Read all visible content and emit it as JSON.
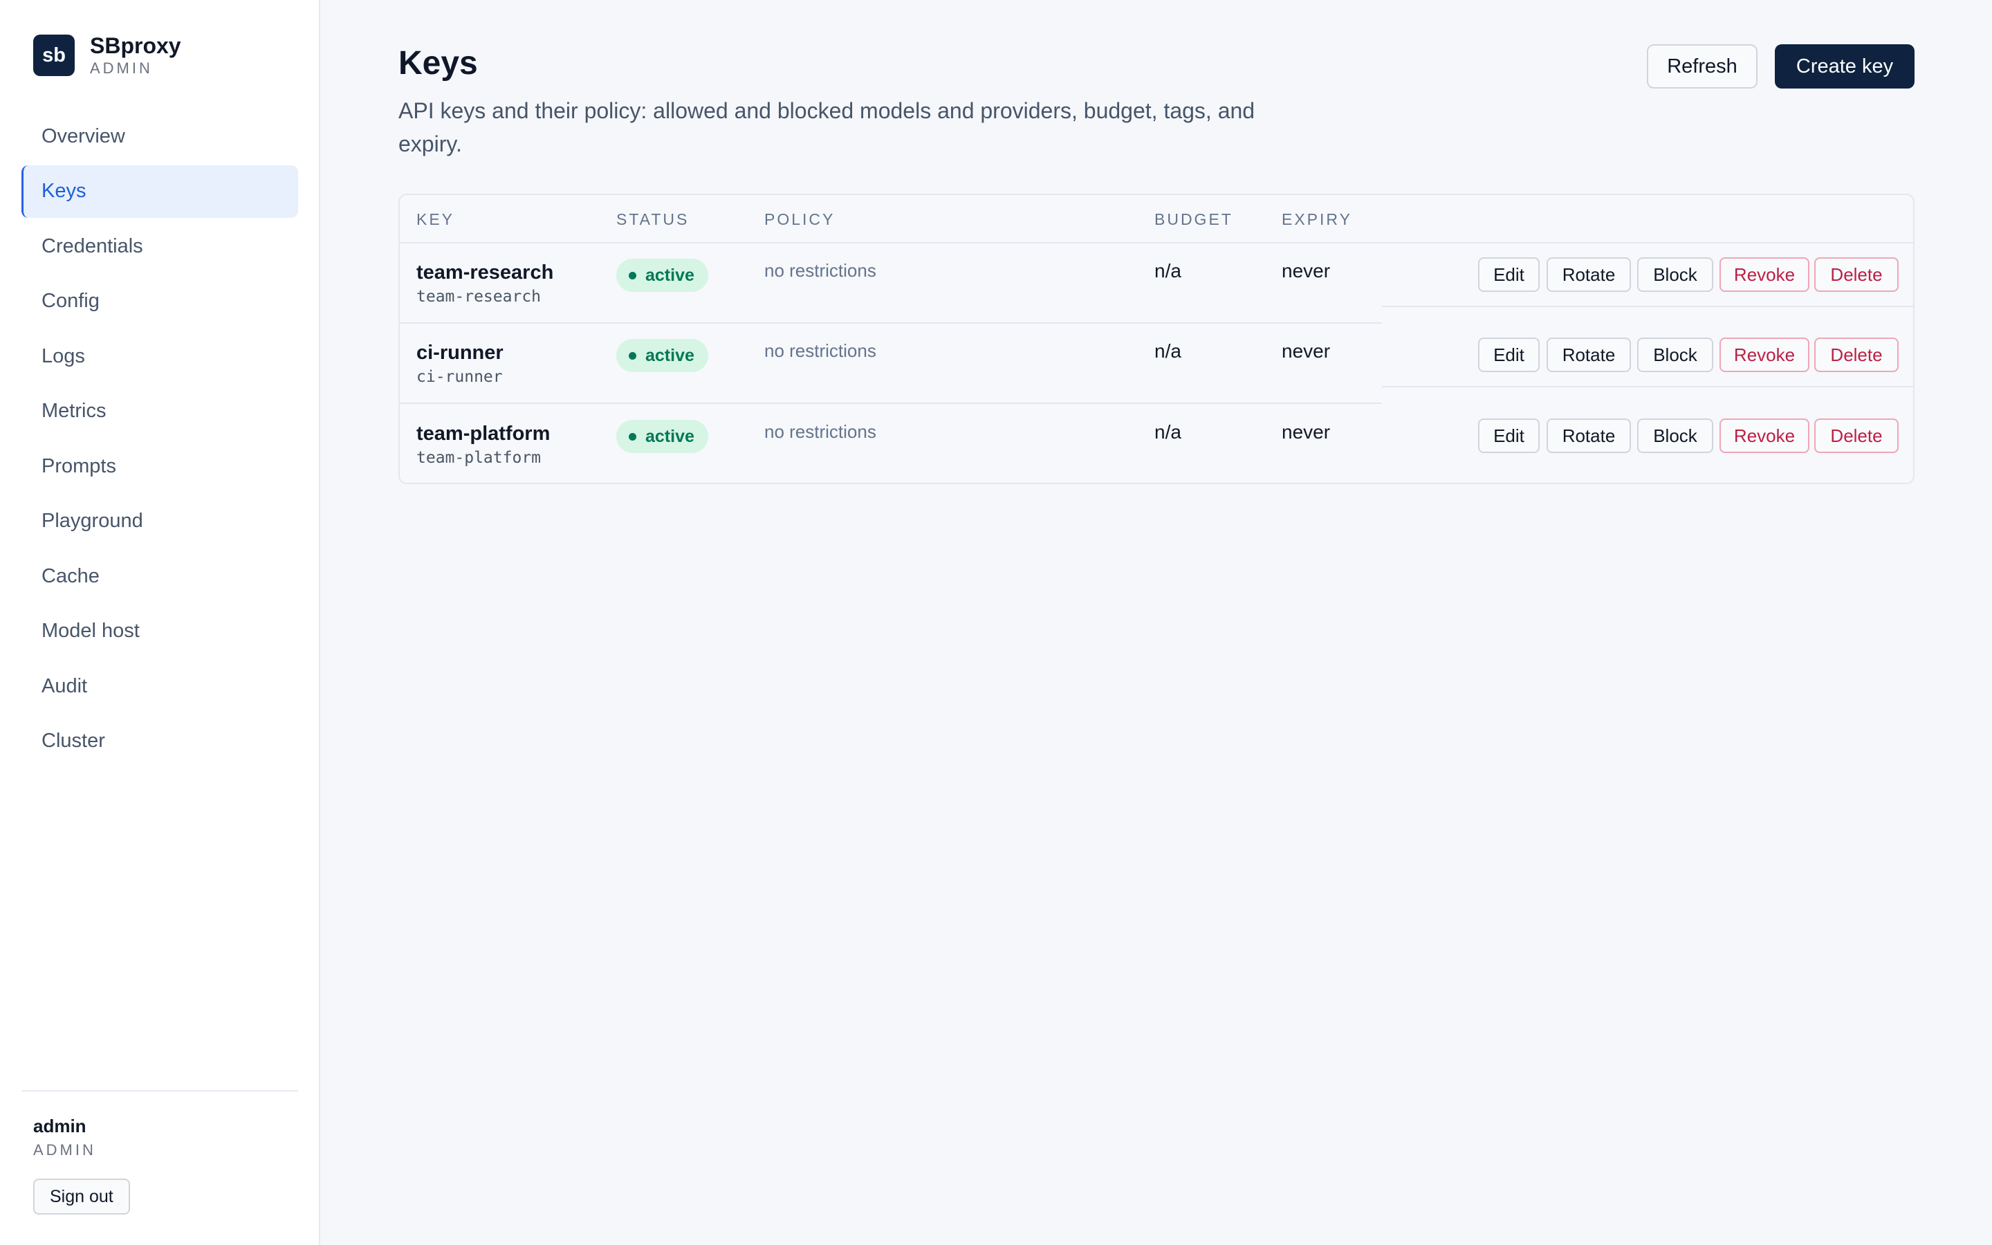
{
  "brand": {
    "logo_text": "sb",
    "name": "SBproxy",
    "sub": "ADMIN"
  },
  "sidebar": {
    "items": [
      {
        "label": "Overview"
      },
      {
        "label": "Keys",
        "active": true
      },
      {
        "label": "Credentials"
      },
      {
        "label": "Config"
      },
      {
        "label": "Logs"
      },
      {
        "label": "Metrics"
      },
      {
        "label": "Prompts"
      },
      {
        "label": "Playground"
      },
      {
        "label": "Cache"
      },
      {
        "label": "Model host"
      },
      {
        "label": "Audit"
      },
      {
        "label": "Cluster"
      }
    ]
  },
  "user": {
    "name": "admin",
    "role": "ADMIN",
    "signout_label": "Sign out"
  },
  "page": {
    "title": "Keys",
    "subtitle": "API keys and their policy: allowed and blocked models and providers, budget, tags, and expiry.",
    "refresh_label": "Refresh",
    "create_label": "Create key"
  },
  "table": {
    "headers": {
      "key": "KEY",
      "status": "STATUS",
      "policy": "POLICY",
      "budget": "BUDGET",
      "expiry": "EXPIRY"
    },
    "rows": [
      {
        "name": "team-research",
        "id": "team-research",
        "status": "active",
        "policy": "no restrictions",
        "budget": "n/a",
        "expiry": "never"
      },
      {
        "name": "ci-runner",
        "id": "ci-runner",
        "status": "active",
        "policy": "no restrictions",
        "budget": "n/a",
        "expiry": "never"
      },
      {
        "name": "team-platform",
        "id": "team-platform",
        "status": "active",
        "policy": "no restrictions",
        "budget": "n/a",
        "expiry": "never"
      }
    ],
    "actions": {
      "edit": "Edit",
      "rotate": "Rotate",
      "block": "Block",
      "revoke": "Revoke",
      "delete": "Delete"
    }
  },
  "colors": {
    "accent": "#2563eb",
    "brand_dark": "#0f2340",
    "status_active": "#047857",
    "danger": "#be1e44"
  }
}
